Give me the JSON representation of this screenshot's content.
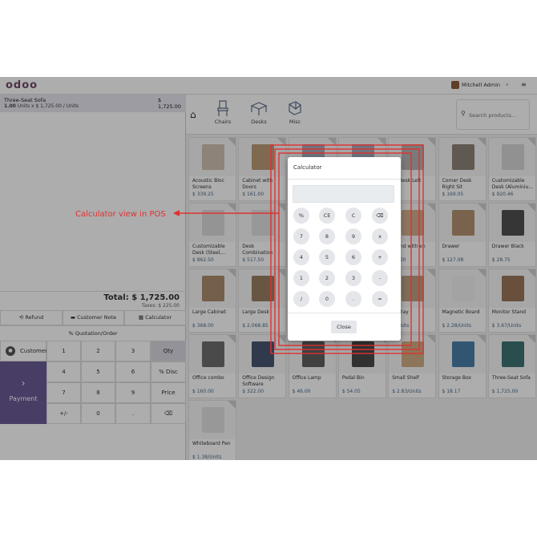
{
  "app": {
    "logo": "odoo",
    "user_name": "Mitchell Admin",
    "icons": [
      "wifi-icon",
      "hamburger-menu-icon",
      "home-icon",
      "search-icon"
    ]
  },
  "order": {
    "line_name": "Three-Seat Sofa",
    "line_price": "$ 1,725.00",
    "line_qty": "1.00",
    "line_detail": "Units x $ 1,725.00 / Units",
    "total": "Total: $ 1,725.00",
    "taxes": "Taxes: $ 225.00"
  },
  "controls": {
    "refund": "Refund",
    "customer_note": "Customer Note",
    "calculator": "Calculator",
    "quotation": "Quotation/Order"
  },
  "numpad": {
    "customer": "Customer",
    "payment": "Payment",
    "keys": [
      "1",
      "2",
      "3",
      "Qty",
      "4",
      "5",
      "6",
      "% Disc",
      "7",
      "8",
      "9",
      "Price",
      "+/-",
      "0",
      ".",
      "⌫"
    ]
  },
  "categories": [
    {
      "label": "Chairs"
    },
    {
      "label": "Desks"
    },
    {
      "label": "Misc"
    }
  ],
  "search": {
    "placeholder": "Search products..."
  },
  "products": [
    {
      "name": "Acoustic Bloc Screens",
      "price": "$ 339.25"
    },
    {
      "name": "Cabinet with Doors",
      "price": "$ 161.00"
    },
    {
      "name": "",
      "price": ""
    },
    {
      "name": "",
      "price": ""
    },
    {
      "name": "er Desk Left",
      "price": "75"
    },
    {
      "name": "Corner Desk Right Sit",
      "price": "$ 169.05"
    },
    {
      "name": "Customizable Desk (Aluminiu...",
      "price": "$ 920.46"
    },
    {
      "name": "Customizable Desk (Steel,...",
      "price": "$ 862.50"
    },
    {
      "name": "Desk Combination",
      "price": "$ 517.50"
    },
    {
      "name": "",
      "price": ""
    },
    {
      "name": "",
      "price": ""
    },
    {
      "name": "Stand with en",
      "price": "15.00"
    },
    {
      "name": "Drawer",
      "price": "$ 127.08"
    },
    {
      "name": "Drawer Black",
      "price": "$ 28.75"
    },
    {
      "name": "Large Cabinet",
      "price": "$ 368.00"
    },
    {
      "name": "Large Desk",
      "price": "$ 2,068.85"
    },
    {
      "name": "",
      "price": ""
    },
    {
      "name": "",
      "price": ""
    },
    {
      "name": "er Tray",
      "price": "2/Units"
    },
    {
      "name": "Magnetic Board",
      "price": "$ 2.28/Units"
    },
    {
      "name": "Monitor Stand",
      "price": "$ 3.67/Units"
    },
    {
      "name": "Office combo",
      "price": "$ 160.00"
    },
    {
      "name": "Office Design Software",
      "price": "$ 322.00"
    },
    {
      "name": "Office Lamp",
      "price": "$ 46.00"
    },
    {
      "name": "Pedal Bin",
      "price": "$ 54.05"
    },
    {
      "name": "Small Shelf",
      "price": "$ 2.83/Units"
    },
    {
      "name": "Storage Box",
      "price": "$ 18.17"
    },
    {
      "name": "Three-Seat Sofa",
      "price": "$ 1,725.00"
    },
    {
      "name": "Whiteboard Pen",
      "price": "$ 1.38/Units"
    }
  ],
  "annotation": "Calculator view in POS",
  "calculator": {
    "title": "Calculator",
    "display": "",
    "keys": [
      "%",
      "CE",
      "C",
      "⌫",
      "7",
      "8",
      "9",
      "x",
      "4",
      "5",
      "6",
      "+",
      "1",
      "2",
      "3",
      "-",
      "/",
      "0",
      ".",
      "="
    ],
    "close": "Close"
  },
  "colors": {
    "brand": "#714b67",
    "payment": "#6b5b95",
    "annotation": "#e03030"
  }
}
